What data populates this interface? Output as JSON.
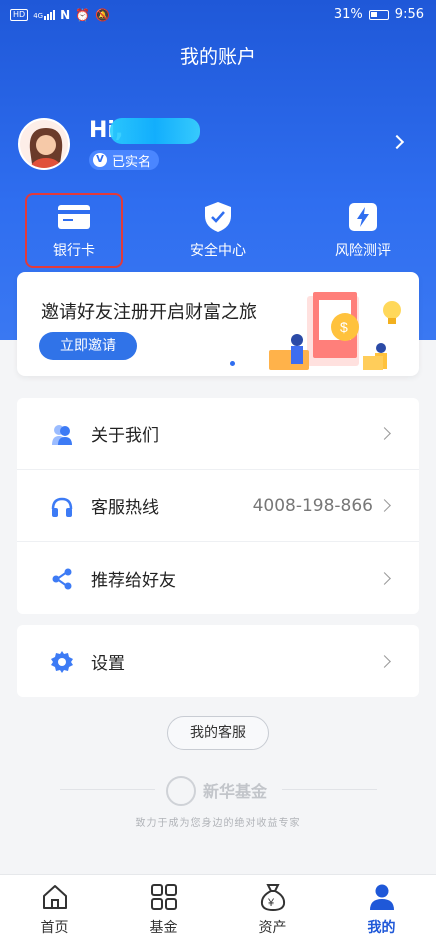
{
  "status_bar": {
    "battery": "31%",
    "time": "9:56",
    "hd_label": "HD",
    "signal_label": "4G"
  },
  "header": {
    "title": "我的账户"
  },
  "profile": {
    "greeting": "Hi,",
    "verified_badge": "V",
    "verified_label": "已实名"
  },
  "quick_actions": [
    {
      "label": "银行卡",
      "icon": "bank-card-icon"
    },
    {
      "label": "安全中心",
      "icon": "shield-check-icon"
    },
    {
      "label": "风险测评",
      "icon": "lightning-icon"
    }
  ],
  "banner": {
    "text": "邀请好友注册开启财富之旅",
    "button": "立即邀请"
  },
  "menu": [
    {
      "label": "关于我们",
      "value": "",
      "icon": "people-icon"
    },
    {
      "label": "客服热线",
      "value": "4008-198-866",
      "icon": "headphones-icon"
    },
    {
      "label": "推荐给好友",
      "value": "",
      "icon": "share-icon"
    }
  ],
  "settings": {
    "label": "设置",
    "icon": "gear-icon"
  },
  "service_button": "我的客服",
  "brand": {
    "name": "新华基金",
    "tagline": "致力于成为您身边的绝对收益专家"
  },
  "tabs": [
    {
      "label": "首页",
      "icon": "home-icon"
    },
    {
      "label": "基金",
      "icon": "grid-icon"
    },
    {
      "label": "资产",
      "icon": "money-bag-icon"
    },
    {
      "label": "我的",
      "icon": "user-icon",
      "active": true
    }
  ],
  "colors": {
    "primary": "#2f6ef0",
    "highlight": "#e23a3a"
  }
}
